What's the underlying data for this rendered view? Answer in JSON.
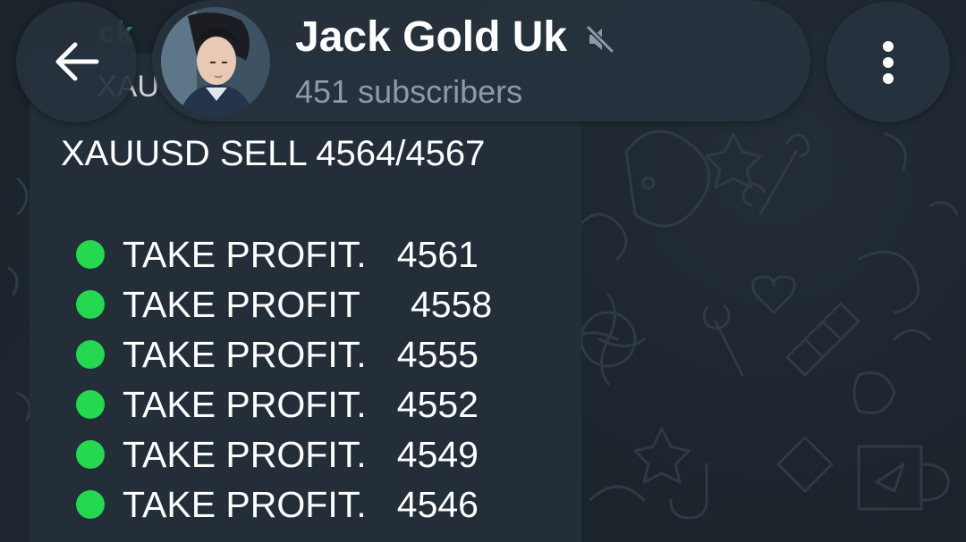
{
  "header": {
    "channel_name": "Jack Gold Uk",
    "subscribers": "451 subscribers",
    "back_icon": "arrow-left-icon",
    "mute_icon": "muted-speaker-icon",
    "menu_icon": "more-vertical-icon",
    "avatar": "channel-avatar"
  },
  "message": {
    "peek_line_1": "ck",
    "peek_line_2": "XAU",
    "title": "XAUUSD SELL 4564/4567",
    "take_profits": [
      {
        "label": "TAKE PROFIT.   4561",
        "status_icon": "green-circle-icon"
      },
      {
        "label": "TAKE PROFIT     4558",
        "status_icon": "green-circle-icon"
      },
      {
        "label": "TAKE PROFIT.   4555",
        "status_icon": "green-circle-icon"
      },
      {
        "label": "TAKE PROFIT.   4552",
        "status_icon": "green-circle-icon"
      },
      {
        "label": "TAKE PROFIT.   4549",
        "status_icon": "green-circle-icon"
      },
      {
        "label": "TAKE PROFIT.   4546",
        "status_icon": "green-circle-icon"
      }
    ]
  },
  "colors": {
    "background": "#1b232b",
    "bubble": "#232e38",
    "status_green": "#24d84f",
    "subtitle_gray": "#8e9ba6"
  }
}
